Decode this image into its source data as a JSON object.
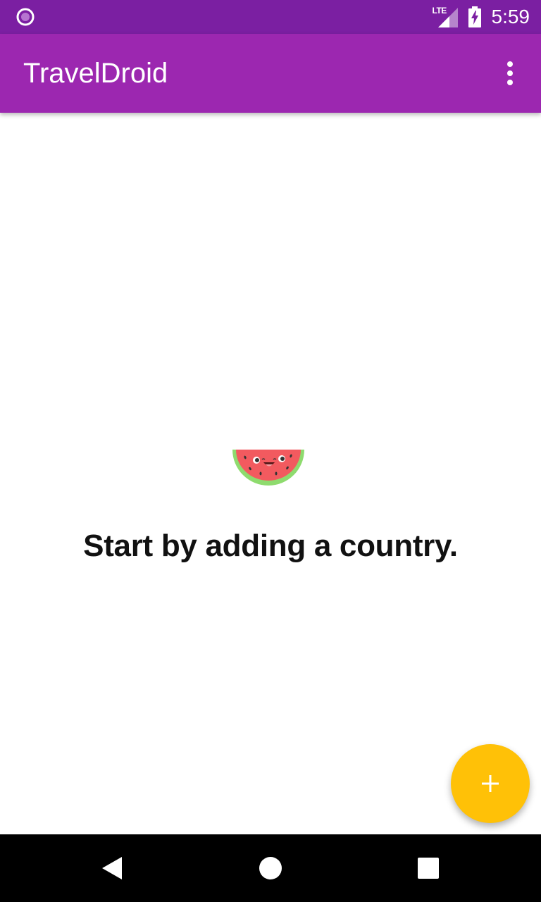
{
  "status_bar": {
    "network_label": "LTE",
    "time": "5:59",
    "left_icon": "circle-notification-icon",
    "signal_icon": "cell-signal-icon",
    "battery_icon": "battery-charging-icon"
  },
  "app_bar": {
    "title": "TravelDroid",
    "overflow_icon": "more-vert-icon"
  },
  "empty_state": {
    "illustration": "watermelon-icon",
    "message": "Start by adding a country."
  },
  "fab": {
    "icon": "plus-icon"
  },
  "nav_bar": {
    "back_icon": "back-triangle-icon",
    "home_icon": "home-circle-icon",
    "recents_icon": "recents-square-icon"
  },
  "colors": {
    "status_bar": "#7B1FA2",
    "app_bar": "#9C27B0",
    "fab": "#FFC107",
    "nav_bar": "#000000"
  }
}
